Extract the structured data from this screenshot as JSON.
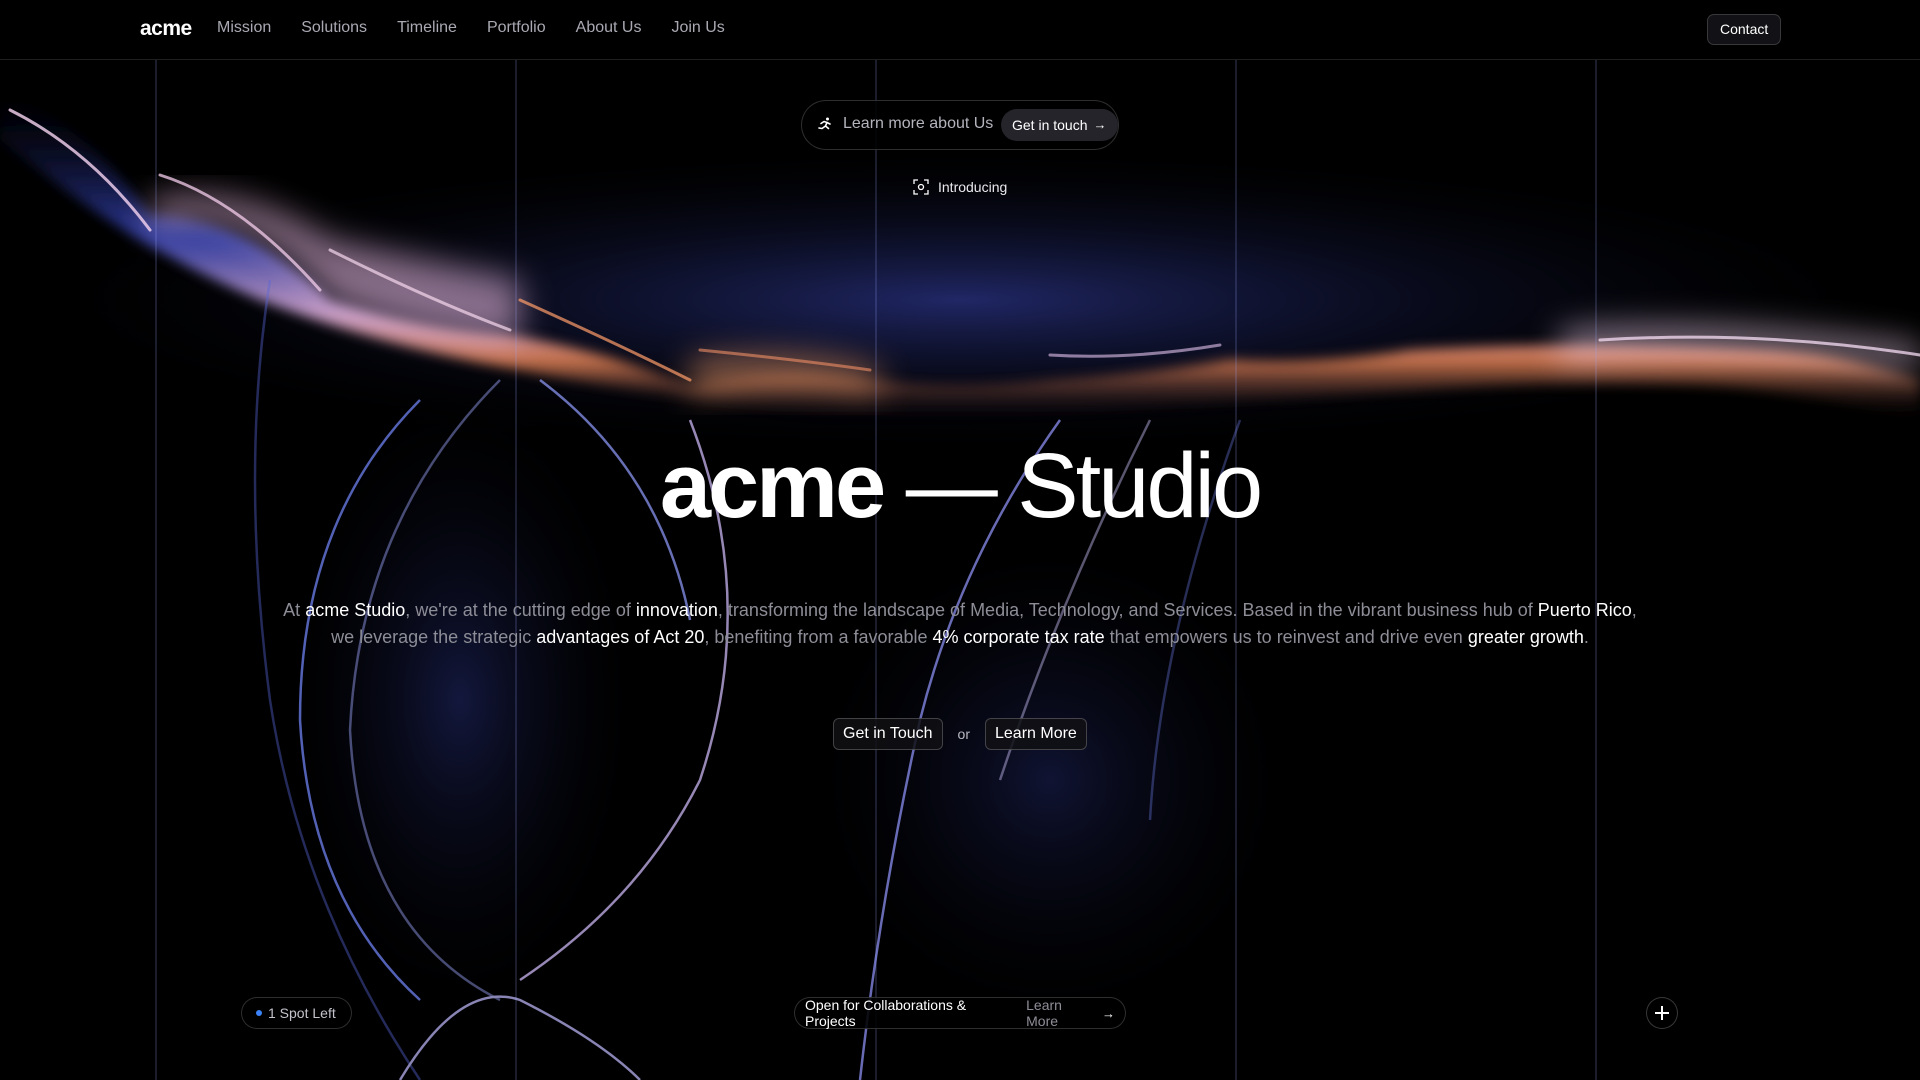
{
  "nav": {
    "brand": "acme",
    "items": [
      {
        "label": "Mission"
      },
      {
        "label": "Solutions"
      },
      {
        "label": "Timeline"
      },
      {
        "label": "Portfolio"
      },
      {
        "label": "About Us"
      },
      {
        "label": "Join Us"
      }
    ],
    "contact_label": "Contact"
  },
  "announcement": {
    "icon": "running-figure-icon",
    "text": "Learn more about Us",
    "button_label": "Get in touch",
    "button_icon": "arrow-right-icon"
  },
  "intro": {
    "icon": "scan-focus-icon",
    "label": "Introducing"
  },
  "hero": {
    "title_bold": "acme",
    "title_light": "— Studio",
    "description": [
      {
        "t": "At ",
        "hl": false
      },
      {
        "t": "acme Studio",
        "hl": true
      },
      {
        "t": ", we're at the cutting edge of ",
        "hl": false
      },
      {
        "t": "innovation",
        "hl": true
      },
      {
        "t": ", transforming the landscape of Media, Technology, and Services. Based in the vibrant business hub of ",
        "hl": false
      },
      {
        "t": "Puerto Rico",
        "hl": true
      },
      {
        "t": ", we leverage the strategic ",
        "hl": false
      },
      {
        "t": "advantages of Act 20",
        "hl": true
      },
      {
        "t": ", benefiting from a favorable ",
        "hl": false
      },
      {
        "t": "4% corporate tax rate",
        "hl": true
      },
      {
        "t": " that empowers us to reinvest and drive even ",
        "hl": false
      },
      {
        "t": "greater growth",
        "hl": true
      },
      {
        "t": ".",
        "hl": false
      }
    ],
    "cta_primary": "Get in Touch",
    "cta_or": "or",
    "cta_secondary": "Learn More"
  },
  "footer_bar": {
    "spots_label": "1 Spot Left",
    "spots_dot_color": "#3b82f6",
    "collab_text": "Open for Collaborations & Projects",
    "collab_link": "Learn More",
    "plus_icon": "plus-icon"
  },
  "colors": {
    "background": "#000000",
    "text_muted": "#8d8d97",
    "highlight": "#ffffff",
    "glow_blue": "#4a5fd6",
    "glow_pink": "#d9a3d6",
    "glow_orange": "#e0764a"
  }
}
